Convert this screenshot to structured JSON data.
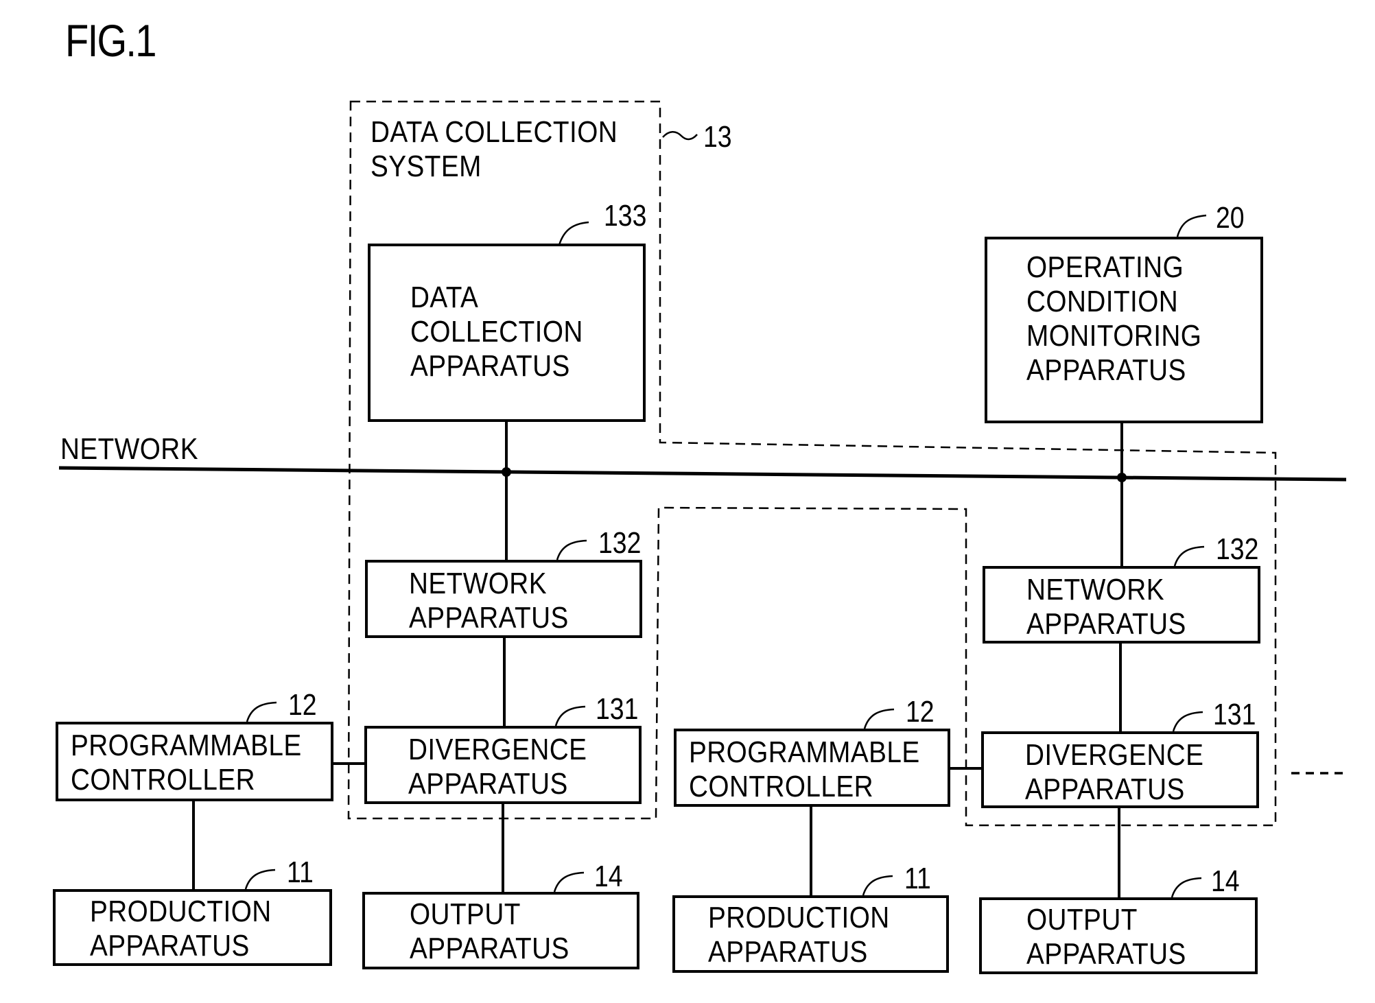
{
  "figure": {
    "title": "FIG.1"
  },
  "network": {
    "label": "NETWORK"
  },
  "system": {
    "label": "DATA COLLECTION\nSYSTEM",
    "ref": "13"
  },
  "monitor": {
    "label": "OPERATING\nCONDITION\nMONITORING\nAPPARATUS",
    "ref": "20"
  },
  "left_group": {
    "data_collection": {
      "label": "DATA\nCOLLECTION\nAPPARATUS",
      "ref": "133"
    },
    "network_apparatus": {
      "label": "NETWORK\nAPPARATUS",
      "ref": "132"
    },
    "divergence": {
      "label": "DIVERGENCE\nAPPARATUS",
      "ref": "131"
    },
    "plc": {
      "label": "PROGRAMMABLE\nCONTROLLER",
      "ref": "12"
    },
    "production": {
      "label": "PRODUCTION\nAPPARATUS",
      "ref": "11"
    },
    "output": {
      "label": "OUTPUT\nAPPARATUS",
      "ref": "14"
    }
  },
  "right_group": {
    "network_apparatus": {
      "label": "NETWORK\nAPPARATUS",
      "ref": "132"
    },
    "divergence": {
      "label": "DIVERGENCE\nAPPARATUS",
      "ref": "131"
    },
    "plc": {
      "label": "PROGRAMMABLE\nCONTROLLER",
      "ref": "12"
    },
    "production": {
      "label": "PRODUCTION\nAPPARATUS",
      "ref": "11"
    },
    "output": {
      "label": "OUTPUT\nAPPARATUS",
      "ref": "14"
    }
  },
  "continuation": {
    "symbol": "----"
  }
}
